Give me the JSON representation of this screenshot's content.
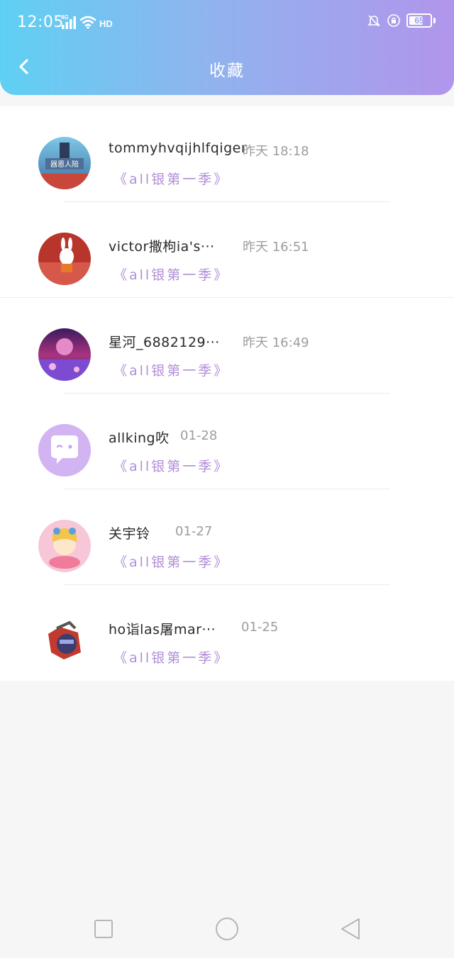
{
  "status_bar": {
    "time": "12:05",
    "network": "4G",
    "hd": "HD",
    "battery": "65"
  },
  "header": {
    "title": "收藏"
  },
  "favorites": [
    {
      "name": "tommyhvqijhlfqiger",
      "time": "昨天 18:18",
      "album": "《all银第一季》"
    },
    {
      "name": "victor撒枸ia's···",
      "time": "昨天 16:51",
      "album": "《all银第一季》"
    },
    {
      "name": "星河_6882129···",
      "time": "昨天 16:49",
      "album": "《all银第一季》"
    },
    {
      "name": "allking吹",
      "time": "01-28",
      "album": "《all银第一季》"
    },
    {
      "name": "关宇铃",
      "time": "01-27",
      "album": "《all银第一季》"
    },
    {
      "name": "ho诣las屠mar···",
      "time": "01-25",
      "album": "《all银第一季》"
    }
  ],
  "icons": {
    "back": "chevron-left-icon",
    "nav_recent": "square-icon",
    "nav_home": "circle-icon",
    "nav_back": "triangle-back-icon"
  },
  "colors": {
    "header_gradient_start": "#5fd0f3",
    "header_gradient_end": "#b195ec",
    "album_text": "#b28ed8"
  }
}
